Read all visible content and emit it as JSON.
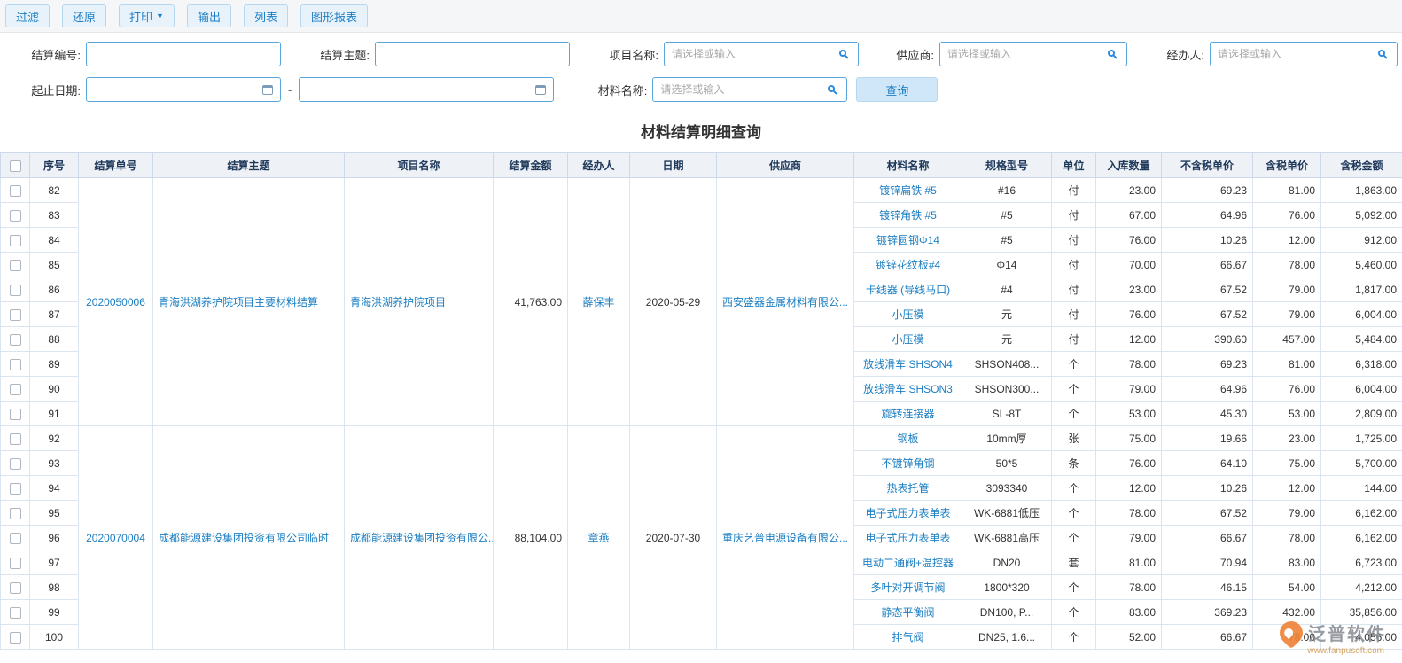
{
  "toolbar": {
    "filter": "过滤",
    "restore": "还原",
    "print": "打印",
    "print_caret": "▼",
    "export": "输出",
    "list": "列表",
    "chart_report": "图形报表"
  },
  "filters": {
    "settlement_no_label": "结算编号:",
    "topic_label": "结算主题:",
    "project_label": "项目名称:",
    "supplier_label": "供应商:",
    "handler_label": "经办人:",
    "date_label": "起止日期:",
    "material_label": "材料名称:",
    "select_placeholder": "请选择或输入",
    "range_separator": "-",
    "search_button": "查询"
  },
  "page_title": "材料结算明细查询",
  "table": {
    "columns": [
      "序号",
      "结算单号",
      "结算主题",
      "项目名称",
      "结算金额",
      "经办人",
      "日期",
      "供应商",
      "材料名称",
      "规格型号",
      "单位",
      "入库数量",
      "不含税单价",
      "含税单价",
      "含税金额"
    ],
    "groups": [
      {
        "settlement_no": "2020050006",
        "topic": "青海洪湖养护院项目主要材料结算",
        "project": "青海洪湖养护院项目",
        "amount": "41,763.00",
        "handler": "薛保丰",
        "date": "2020-05-29",
        "supplier": "西安盛器金属材料有限公...",
        "rows": [
          {
            "no": "82",
            "material": "镀锌扁铁 #5",
            "spec": "#16",
            "unit": "付",
            "qty": "23.00",
            "price_ex": "69.23",
            "price_in": "81.00",
            "amount_in": "1,863.00"
          },
          {
            "no": "83",
            "material": "镀锌角铁 #5",
            "spec": "#5",
            "unit": "付",
            "qty": "67.00",
            "price_ex": "64.96",
            "price_in": "76.00",
            "amount_in": "5,092.00"
          },
          {
            "no": "84",
            "material": "镀锌圆钢Φ14",
            "spec": "#5",
            "unit": "付",
            "qty": "76.00",
            "price_ex": "10.26",
            "price_in": "12.00",
            "amount_in": "912.00"
          },
          {
            "no": "85",
            "material": "镀锌花纹板#4",
            "spec": "Φ14",
            "unit": "付",
            "qty": "70.00",
            "price_ex": "66.67",
            "price_in": "78.00",
            "amount_in": "5,460.00"
          },
          {
            "no": "86",
            "material": "卡线器 (导线马口)",
            "spec": "#4",
            "unit": "付",
            "qty": "23.00",
            "price_ex": "67.52",
            "price_in": "79.00",
            "amount_in": "1,817.00"
          },
          {
            "no": "87",
            "material": "小压模",
            "spec": "元",
            "unit": "付",
            "qty": "76.00",
            "price_ex": "67.52",
            "price_in": "79.00",
            "amount_in": "6,004.00"
          },
          {
            "no": "88",
            "material": "小压模",
            "spec": "元",
            "unit": "付",
            "qty": "12.00",
            "price_ex": "390.60",
            "price_in": "457.00",
            "amount_in": "5,484.00"
          },
          {
            "no": "89",
            "material": "放线滑车 SHSON4",
            "spec": "SHSON408...",
            "unit": "个",
            "qty": "78.00",
            "price_ex": "69.23",
            "price_in": "81.00",
            "amount_in": "6,318.00"
          },
          {
            "no": "90",
            "material": "放线滑车 SHSON3",
            "spec": "SHSON300...",
            "unit": "个",
            "qty": "79.00",
            "price_ex": "64.96",
            "price_in": "76.00",
            "amount_in": "6,004.00"
          },
          {
            "no": "91",
            "material": "旋转连接器",
            "spec": "SL-8T",
            "unit": "个",
            "qty": "53.00",
            "price_ex": "45.30",
            "price_in": "53.00",
            "amount_in": "2,809.00"
          }
        ]
      },
      {
        "settlement_no": "2020070004",
        "topic": "成都能源建设集团投资有限公司临时",
        "project": "成都能源建设集团投资有限公...",
        "amount": "88,104.00",
        "handler": "章燕",
        "date": "2020-07-30",
        "supplier": "重庆艺普电源设备有限公...",
        "rows": [
          {
            "no": "92",
            "material": "钢板",
            "spec": "10mm厚",
            "unit": "张",
            "qty": "75.00",
            "price_ex": "19.66",
            "price_in": "23.00",
            "amount_in": "1,725.00"
          },
          {
            "no": "93",
            "material": "不镀锌角钢",
            "spec": "50*5",
            "unit": "条",
            "qty": "76.00",
            "price_ex": "64.10",
            "price_in": "75.00",
            "amount_in": "5,700.00"
          },
          {
            "no": "94",
            "material": "热表托管",
            "spec": "3093340",
            "unit": "个",
            "qty": "12.00",
            "price_ex": "10.26",
            "price_in": "12.00",
            "amount_in": "144.00"
          },
          {
            "no": "95",
            "material": "电子式压力表单表",
            "spec": "WK-6881低压",
            "unit": "个",
            "qty": "78.00",
            "price_ex": "67.52",
            "price_in": "79.00",
            "amount_in": "6,162.00"
          },
          {
            "no": "96",
            "material": "电子式压力表单表",
            "spec": "WK-6881高压",
            "unit": "个",
            "qty": "79.00",
            "price_ex": "66.67",
            "price_in": "78.00",
            "amount_in": "6,162.00"
          },
          {
            "no": "97",
            "material": "电动二通阀+温控器",
            "spec": "DN20",
            "unit": "套",
            "qty": "81.00",
            "price_ex": "70.94",
            "price_in": "83.00",
            "amount_in": "6,723.00"
          },
          {
            "no": "98",
            "material": "多叶对开调节阀",
            "spec": "1800*320",
            "unit": "个",
            "qty": "78.00",
            "price_ex": "46.15",
            "price_in": "54.00",
            "amount_in": "4,212.00"
          },
          {
            "no": "99",
            "material": "静态平衡阀",
            "spec": "DN100, P...",
            "unit": "个",
            "qty": "83.00",
            "price_ex": "369.23",
            "price_in": "432.00",
            "amount_in": "35,856.00"
          },
          {
            "no": "100",
            "material": "排气阀",
            "spec": "DN25, 1.6...",
            "unit": "个",
            "qty": "52.00",
            "price_ex": "66.67",
            "price_in": "78.00",
            "amount_in": "4,056.00"
          }
        ]
      }
    ]
  },
  "watermark": {
    "brand": "泛普软件",
    "url": "www.fanpusoft.com"
  }
}
